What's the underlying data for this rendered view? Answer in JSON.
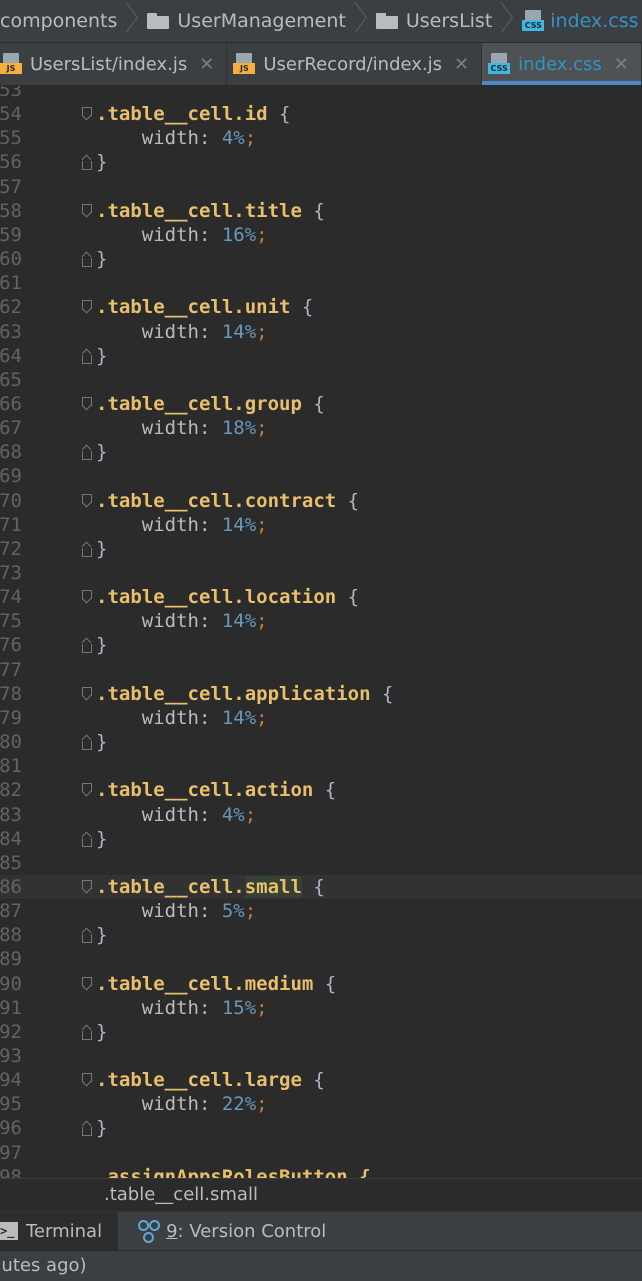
{
  "breadcrumb": [
    "components",
    "UserManagement",
    "UsersList",
    "index.css"
  ],
  "tabs": [
    {
      "label": "UsersList/index.js",
      "icon": "js-file-icon"
    },
    {
      "label": "UserRecord/index.js",
      "icon": "js-file-icon"
    },
    {
      "label": "index.css",
      "icon": "css-file-icon",
      "active": true
    }
  ],
  "editor": {
    "first_line_number": 53,
    "current_line": 86,
    "rules": [
      {
        "selector": ".table__cell.id",
        "value": "4"
      },
      {
        "selector": ".table__cell.title",
        "value": "16"
      },
      {
        "selector": ".table__cell.unit",
        "value": "14"
      },
      {
        "selector": ".table__cell.group",
        "value": "18"
      },
      {
        "selector": ".table__cell.contract",
        "value": "14"
      },
      {
        "selector": ".table__cell.location",
        "value": "14"
      },
      {
        "selector": ".table__cell.application",
        "value": "14"
      },
      {
        "selector": ".table__cell.action",
        "value": "4"
      },
      {
        "selector": ".table__cell.small",
        "value": "5"
      },
      {
        "selector": ".table__cell.medium",
        "value": "15"
      },
      {
        "selector": ".table__cell.large",
        "value": "22"
      }
    ],
    "property": "width",
    "unit": "%",
    "trailing_line": ".assignAppsRolesButton {"
  },
  "footer_breadcrumb": ".table__cell.small",
  "toolwindow": {
    "terminal_label": "Terminal",
    "vc_number": "9",
    "vc_label": ": Version Control"
  },
  "status_text": "nutes ago)",
  "colors": {
    "selector": "#e8bf6a",
    "number": "#6897bb",
    "semicolon": "#cc7832",
    "background": "#2b2b2b",
    "active_tab_text": "#3592c4"
  }
}
